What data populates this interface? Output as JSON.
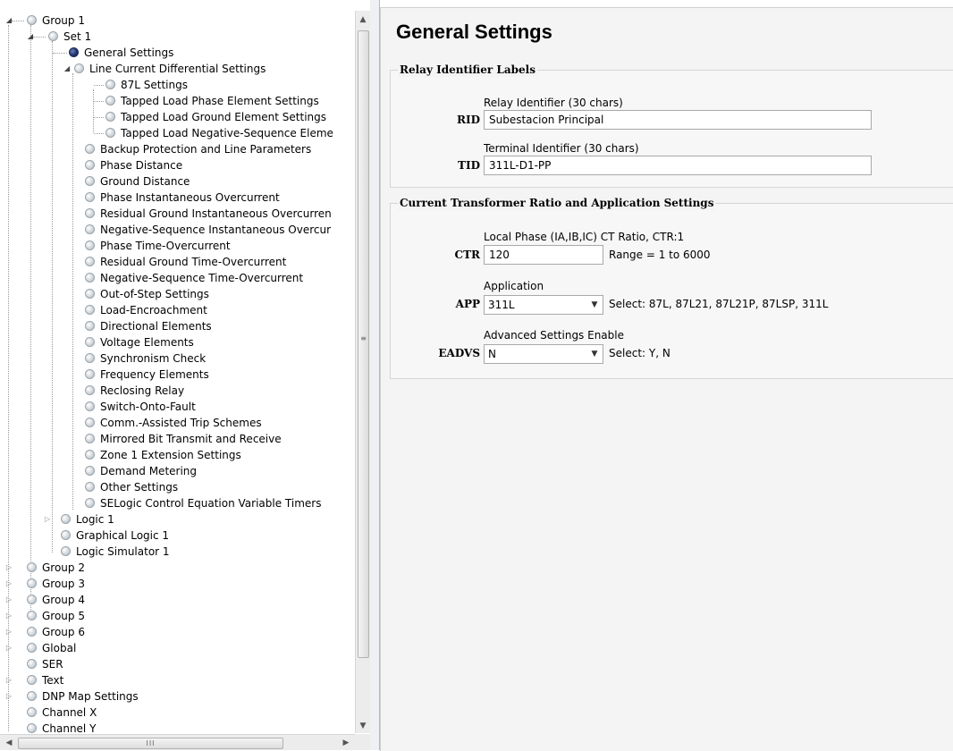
{
  "tree": {
    "group1": {
      "label": "Group 1"
    },
    "set1": {
      "label": "Set 1",
      "general_settings": "General Settings",
      "lcd": {
        "label": "Line Current Differential Settings",
        "children": [
          "87L Settings",
          "Tapped Load Phase Element Settings",
          "Tapped Load Ground Element Settings",
          "Tapped Load Negative-Sequence Eleme"
        ]
      },
      "items": [
        "Backup Protection and Line Parameters",
        "Phase Distance",
        "Ground Distance",
        "Phase Instantaneous Overcurrent",
        "Residual Ground Instantaneous Overcurren",
        "Negative-Sequence Instantaneous Overcur",
        "Phase Time-Overcurrent",
        "Residual Ground Time-Overcurrent",
        "Negative-Sequence Time-Overcurrent",
        "Out-of-Step Settings",
        "Load-Encroachment",
        "Directional Elements",
        "Voltage Elements",
        "Synchronism Check",
        "Frequency Elements",
        "Reclosing Relay",
        "Switch-Onto-Fault",
        "Comm.-Assisted Trip Schemes",
        "Mirrored Bit Transmit and Receive",
        "Zone 1 Extension Settings",
        "Demand Metering",
        "Other Settings",
        "SELogic Control Equation Variable Timers"
      ]
    },
    "group1_children": [
      "Logic 1",
      "Graphical Logic 1",
      "Logic Simulator 1"
    ],
    "root_items": [
      "Group 2",
      "Group 3",
      "Group 4",
      "Group 5",
      "Group 6",
      "Global",
      "SER",
      "Text",
      "DNP Map Settings",
      "Channel X",
      "Channel Y"
    ],
    "scroll_grip": "≡",
    "hscroll_grip": "III"
  },
  "settings": {
    "title": "General Settings",
    "relay_id_group": {
      "title": "Relay Identifier Labels",
      "rid": {
        "caption": "Relay Identifier (30 chars)",
        "label": "RID",
        "value": "Subestacion Principal"
      },
      "tid": {
        "caption": "Terminal Identifier (30 chars)",
        "label": "TID",
        "value": "311L-D1-PP"
      }
    },
    "ct_group": {
      "title": "Current Transformer Ratio and Application Settings",
      "ctr": {
        "caption": "Local Phase (IA,IB,IC) CT Ratio, CTR:1",
        "label": "CTR",
        "value": "120",
        "hint": "Range = 1 to 6000"
      },
      "app": {
        "caption": "Application",
        "label": "APP",
        "value": "311L",
        "hint": "Select: 87L, 87L21, 87L21P, 87LSP, 311L"
      },
      "eadvs": {
        "caption": "Advanced Settings Enable",
        "label": "EADVS",
        "value": "N",
        "hint": "Select: Y, N"
      }
    }
  }
}
